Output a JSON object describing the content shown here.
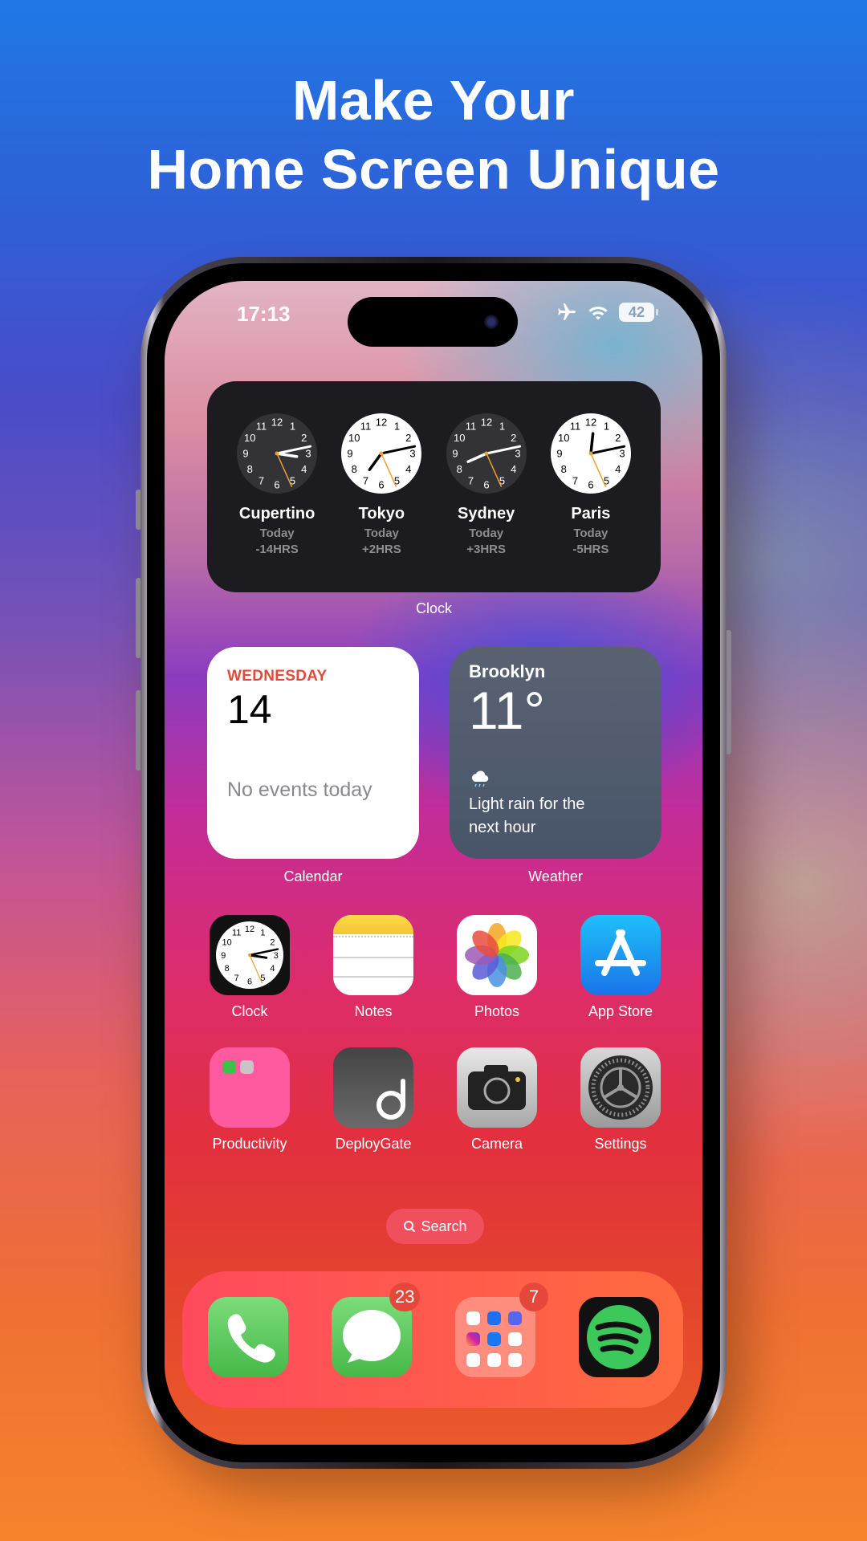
{
  "headline": {
    "line1": "Make Your",
    "line2": "Home Screen Unique"
  },
  "status_bar": {
    "time": "17:13",
    "battery": "42",
    "icons": [
      "airplane-icon",
      "wifi-icon",
      "battery-icon"
    ]
  },
  "clock_widget": {
    "label": "Clock",
    "clocks": [
      {
        "city": "Cupertino",
        "day": "Today",
        "offset": "-14HRS",
        "face": "dark",
        "hour": 3.3,
        "minute": 13,
        "second": 26
      },
      {
        "city": "Tokyo",
        "day": "Today",
        "offset": "+2HRS",
        "face": "light",
        "hour": 7.2,
        "minute": 13,
        "second": 26
      },
      {
        "city": "Sydney",
        "day": "Today",
        "offset": "+3HRS",
        "face": "dark",
        "hour": 8.2,
        "minute": 13,
        "second": 26
      },
      {
        "city": "Paris",
        "day": "Today",
        "offset": "-5HRS",
        "face": "light",
        "hour": 12.2,
        "minute": 13,
        "second": 26
      }
    ]
  },
  "calendar_widget": {
    "label": "Calendar",
    "weekday": "WEDNESDAY",
    "date": "14",
    "events": "No events today"
  },
  "weather_widget": {
    "label": "Weather",
    "city": "Brooklyn",
    "temperature": "11°",
    "icon": "cloud-rain-icon",
    "description_line1": "Light rain for the",
    "description_line2": "next hour"
  },
  "apps": [
    {
      "name": "Clock",
      "icon": "clock-app-icon"
    },
    {
      "name": "Notes",
      "icon": "notes-app-icon"
    },
    {
      "name": "Photos",
      "icon": "photos-app-icon"
    },
    {
      "name": "App Store",
      "icon": "app-store-icon"
    },
    {
      "name": "Productivity",
      "icon": "productivity-folder-icon"
    },
    {
      "name": "DeployGate",
      "icon": "deploygate-app-icon"
    },
    {
      "name": "Camera",
      "icon": "camera-app-icon"
    },
    {
      "name": "Settings",
      "icon": "settings-app-icon"
    }
  ],
  "search": {
    "label": "Search"
  },
  "dock": {
    "apps": [
      {
        "name": "Phone",
        "icon": "phone-app-icon",
        "badge": null
      },
      {
        "name": "Messages",
        "icon": "messages-app-icon",
        "badge": "23"
      },
      {
        "name": "Social Folder",
        "icon": "social-folder-icon",
        "badge": "7"
      },
      {
        "name": "Spotify",
        "icon": "spotify-app-icon",
        "badge": null
      }
    ]
  },
  "colors": {
    "accent_red": "#e5483a",
    "calendar_red": "#e5483a",
    "spotify_green": "#1ed760",
    "clock_second_hand": "#f0a030"
  }
}
